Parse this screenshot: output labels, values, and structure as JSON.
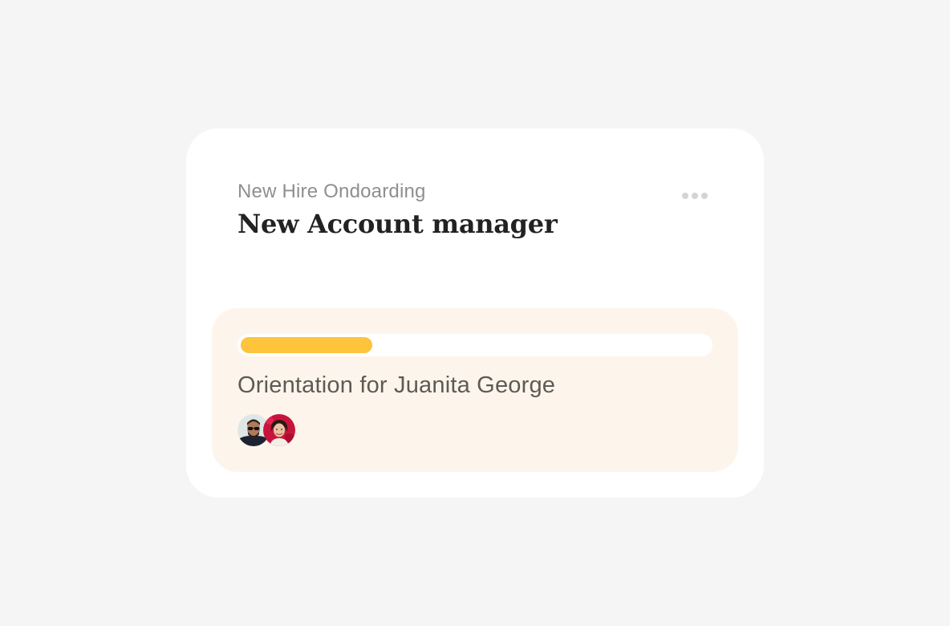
{
  "card": {
    "subtitle": "New Hire Ondoarding",
    "title": "New Account manager",
    "more_icon": "more-horizontal-icon"
  },
  "task": {
    "title": "Orientation for Juanita George",
    "progress_percent": 28,
    "progress_color": "#fdc43c",
    "panel_color": "#fdf5ec",
    "assignees": [
      {
        "avatar": "avatar-man-sunglasses"
      },
      {
        "avatar": "avatar-woman-red-background"
      }
    ]
  }
}
